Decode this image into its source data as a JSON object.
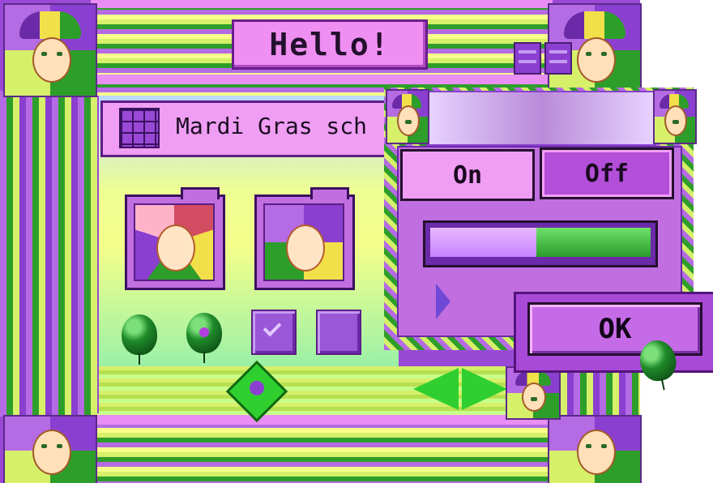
{
  "window": {
    "title": "Hello!"
  },
  "app_bar": {
    "name": "Mardi Gras sch"
  },
  "icons": {
    "title_corner": "jester-mask-icon",
    "folders": [
      "portrait-folder-icon",
      "jester-folder-icon"
    ],
    "balloons": [
      "green-balloon-icon",
      "balloon-with-dot-icon"
    ],
    "checkboxes": [
      "checkbox-checked",
      "checkbox-unchecked"
    ]
  },
  "dialog": {
    "toggle": {
      "on_label": "On",
      "off_label": "Off",
      "selected": "Off"
    },
    "progress": {
      "value": 0.48
    },
    "ok_label": "OK"
  },
  "colors": {
    "purple": "#9a49d6",
    "pink": "#f09ef4",
    "green": "#2e9e2a",
    "yellow": "#f2e04a"
  }
}
